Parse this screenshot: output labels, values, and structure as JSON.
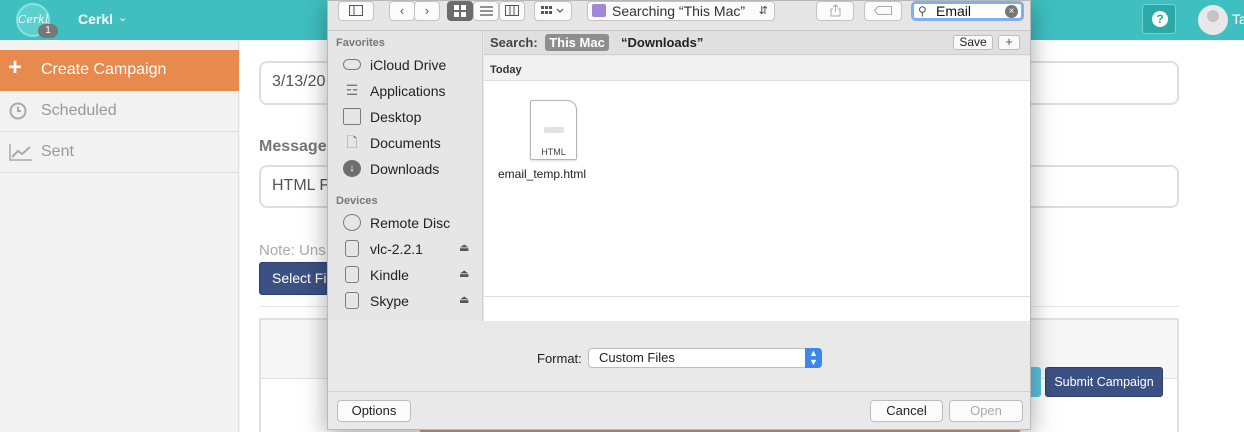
{
  "app": {
    "logo_text": "Cerkl",
    "logo_badge": "1",
    "brand": "Cerkl",
    "brand_caret": "⌄",
    "help_icon": "?",
    "user_name": "Ta"
  },
  "sidebar": {
    "items": [
      {
        "label": "Create Campaign",
        "icon": "plus-icon",
        "glyph": "+"
      },
      {
        "label": "Scheduled",
        "icon": "clock-icon",
        "glyph": "◷"
      },
      {
        "label": "Sent",
        "icon": "chart-icon",
        "glyph": "⟋"
      }
    ]
  },
  "main": {
    "date_value": "3/13/20",
    "message_label": "Message",
    "message_value": "HTML F",
    "note": "Note: Uns",
    "select_file": "Select Fil",
    "submit": "Submit Campaign"
  },
  "dialog": {
    "location": "Searching “This Mac”",
    "search_value": "Email",
    "search_label": "Search:",
    "scope_this_mac": "This Mac",
    "scope_folder": "“Downloads”",
    "save": "Save",
    "add": "+",
    "favorites_header": "Favorites",
    "favorites": [
      {
        "label": "iCloud Drive",
        "icon": "cloud-icon"
      },
      {
        "label": "Applications",
        "icon": "applications-icon"
      },
      {
        "label": "Desktop",
        "icon": "desktop-icon"
      },
      {
        "label": "Documents",
        "icon": "documents-icon"
      },
      {
        "label": "Downloads",
        "icon": "downloads-icon"
      }
    ],
    "devices_header": "Devices",
    "devices": [
      {
        "label": "Remote Disc",
        "icon": "disc-icon",
        "eject": ""
      },
      {
        "label": "vlc-2.2.1",
        "icon": "drive-icon",
        "eject": "⏏"
      },
      {
        "label": "Kindle",
        "icon": "drive-icon",
        "eject": "⏏"
      },
      {
        "label": "Skype",
        "icon": "drive-icon",
        "eject": "⏏"
      }
    ],
    "section": "Today",
    "file": {
      "name": "email_temp.html",
      "type": "HTML"
    },
    "format_label": "Format:",
    "format_value": "Custom Files",
    "options": "Options",
    "cancel": "Cancel",
    "open": "Open"
  },
  "colors": {
    "topbar": "#3fbfbf",
    "active_sidebar": "#e8894e",
    "primary_button": "#3c5183",
    "mac_accent": "#3c87e8"
  }
}
